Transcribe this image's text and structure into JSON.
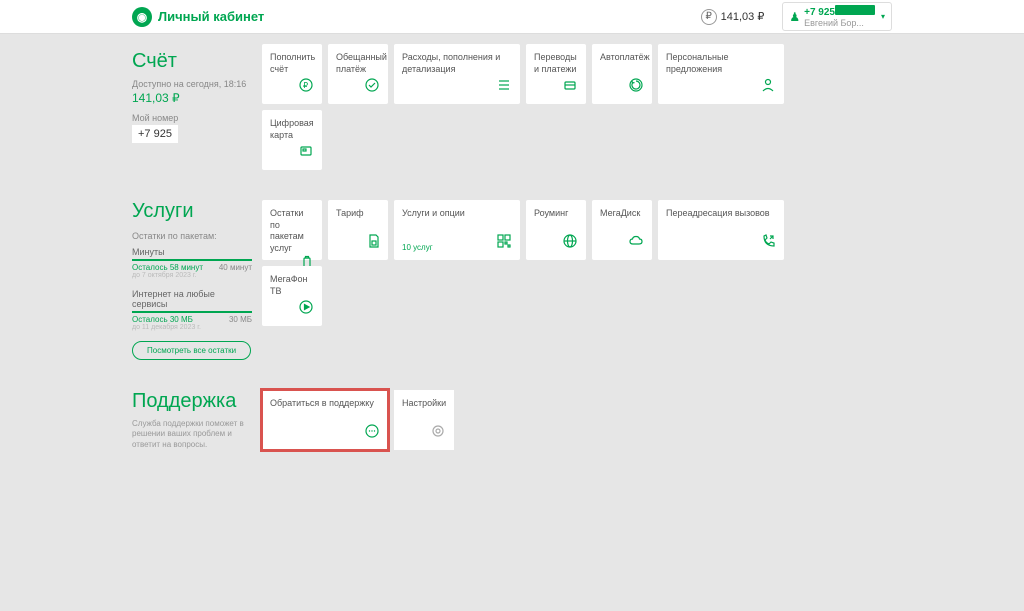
{
  "header": {
    "brand": "Личный кабинет",
    "balance": "141,03 ₽",
    "user_phone": "+7 925",
    "user_name": "Евгений Бор..."
  },
  "account": {
    "title": "Счёт",
    "available_label": "Доступно на сегодня, 18:16",
    "amount": "141,03 ₽",
    "mynum_label": "Мой номер",
    "mynum": "+7 925",
    "cards": {
      "topup": "Пополнить счёт",
      "promised": "Обещанный платёж",
      "expenses": "Расходы, пополнения и детализация",
      "transfers": "Переводы и платежи",
      "autopay": "Автоплатёж",
      "offers": "Персональные предложения",
      "digital": "Цифровая карта"
    }
  },
  "services": {
    "title": "Услуги",
    "packages_label": "Остатки по пакетам:",
    "minutes": {
      "name": "Минуты",
      "left": "Осталось 58 минут",
      "total": "40 минут",
      "date": "до 7 октября 2023 г."
    },
    "internet": {
      "name": "Интернет на любые сервисы",
      "left": "Осталось 30 МБ",
      "total": "30 МБ",
      "date": "до 11 декабря 2023 г."
    },
    "view_all_btn": "Посмотреть все остатки",
    "cards": {
      "remains": "Остатки по пакетам услуг",
      "tariff": "Тариф",
      "options": "Услуги и опции",
      "options_count": "10 услуг",
      "roaming": "Роуминг",
      "megadisk": "МегаДиск",
      "forward": "Переадресация вызовов",
      "megafontv": "МегаФон ТВ"
    }
  },
  "support": {
    "title": "Поддержка",
    "desc": "Служба поддержки поможет в решении ваших проблем и ответит на вопросы.",
    "contact": "Обратиться в поддержку",
    "settings": "Настройки"
  }
}
